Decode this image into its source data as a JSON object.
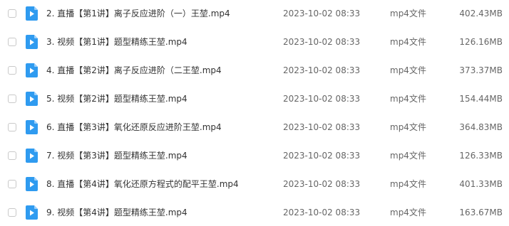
{
  "colors": {
    "icon_blue": "#2f9bf0",
    "icon_fold": "#9ccffa",
    "checkbox_border": "#c9c9c9",
    "text_primary": "#333333",
    "text_secondary": "#666666"
  },
  "files": [
    {
      "name": "2. 直播【第1讲】离子反应进阶（一）王堃.mp4",
      "date": "2023-10-02 08:33",
      "type": "mp4文件",
      "size": "402.43MB",
      "icon": "video-file-icon"
    },
    {
      "name": "3. 视频【第1讲】题型精练王堃.mp4",
      "date": "2023-10-02 08:33",
      "type": "mp4文件",
      "size": "126.16MB",
      "icon": "video-file-icon"
    },
    {
      "name": "4. 直播【第2讲】离子反应进阶（二王堃.mp4",
      "date": "2023-10-02 08:33",
      "type": "mp4文件",
      "size": "373.37MB",
      "icon": "video-file-icon"
    },
    {
      "name": "5. 视频【第2讲】题型精练王堃.mp4",
      "date": "2023-10-02 08:33",
      "type": "mp4文件",
      "size": "154.44MB",
      "icon": "video-file-icon"
    },
    {
      "name": "6. 直播【第3讲】氧化还原反应进阶王堃.mp4",
      "date": "2023-10-02 08:33",
      "type": "mp4文件",
      "size": "364.83MB",
      "icon": "video-file-icon"
    },
    {
      "name": "7. 视频【第3讲】题型精练王堃.mp4",
      "date": "2023-10-02 08:33",
      "type": "mp4文件",
      "size": "126.33MB",
      "icon": "video-file-icon"
    },
    {
      "name": "8. 直播【第4讲】氧化还原方程式的配平王堃.mp4",
      "date": "2023-10-02 08:33",
      "type": "mp4文件",
      "size": "401.33MB",
      "icon": "video-file-icon"
    },
    {
      "name": "9. 视频【第4讲】题型精练王堃.mp4",
      "date": "2023-10-02 08:33",
      "type": "mp4文件",
      "size": "163.67MB",
      "icon": "video-file-icon"
    }
  ]
}
